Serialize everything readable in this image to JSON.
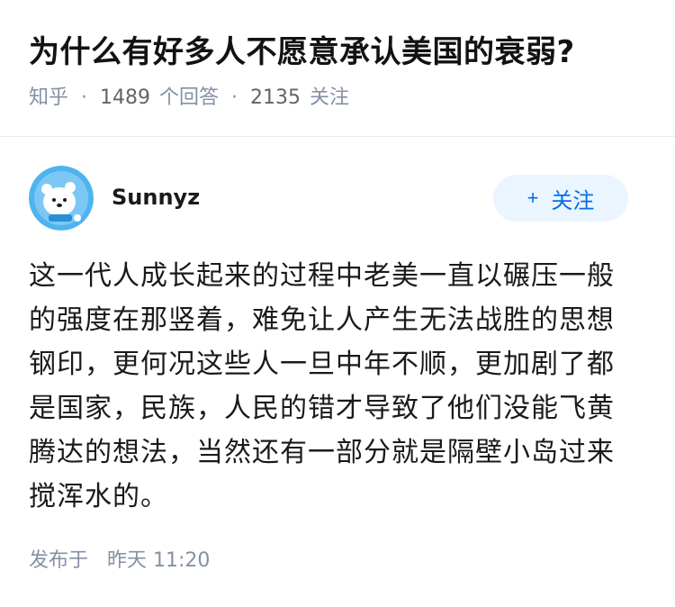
{
  "question": {
    "title": "为什么有好多人不愿意承认美国的衰弱?",
    "source": "知乎",
    "separator": "·",
    "answer_count": "1489",
    "answer_label": "个回答",
    "follower_count": "2135",
    "follower_label": "关注"
  },
  "author": {
    "name": "Sunnyz",
    "avatar_icon": "polar-bear-avatar-icon",
    "follow_plus": "+",
    "follow_label": "关注"
  },
  "answer": {
    "content": "这一代人成长起来的过程中老美一直以碾压一般的强度在那竖着，难免让人产生无法战胜的思想钢印，更何况这些人一旦中年不顺，更加剧了都是国家，民族，人民的错才导致了他们没能飞黄腾达的想法，当然还有一部分就是隔壁小岛过来搅浑水的。",
    "publish_label": "发布于",
    "publish_time": "昨天 11:20"
  },
  "colors": {
    "accent": "#056de8",
    "follow_bg": "#ebf5ff",
    "meta": "#8590a6",
    "avatar_bg": "#4fb3f0"
  }
}
